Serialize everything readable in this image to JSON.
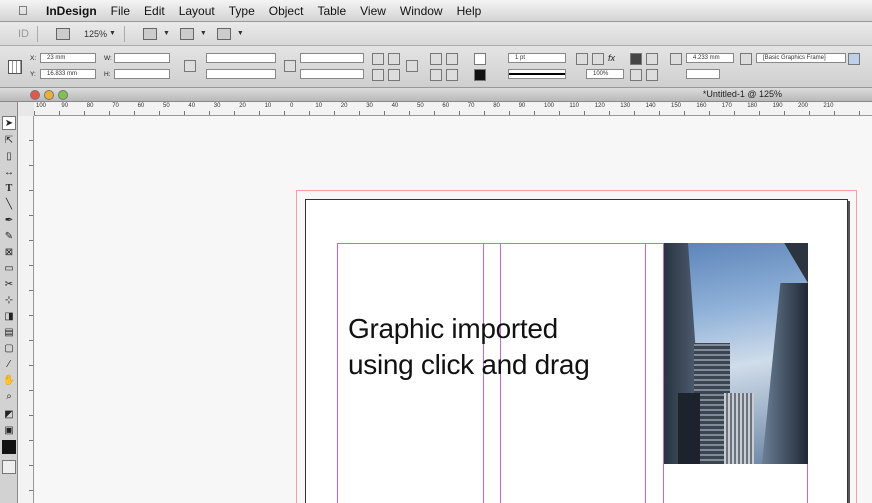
{
  "menubar": {
    "app_name": "InDesign",
    "items": [
      "File",
      "Edit",
      "Layout",
      "Type",
      "Object",
      "Table",
      "View",
      "Window",
      "Help"
    ]
  },
  "appbar": {
    "zoom": "125%"
  },
  "control": {
    "x_label": "X:",
    "x_value": "23 mm",
    "y_label": "Y:",
    "y_value": "16.833 mm",
    "w_label": "W:",
    "h_label": "H:",
    "stroke_weight": "1 pt",
    "opacity": "100%",
    "dimension": "4.233 mm",
    "object_style": "[Basic Graphics Frame]"
  },
  "document": {
    "title": "*Untitled-1 @ 125%"
  },
  "ruler": {
    "ticks": [
      "100",
      "90",
      "80",
      "70",
      "60",
      "50",
      "40",
      "30",
      "20",
      "10",
      "0",
      "10",
      "20",
      "30",
      "40",
      "50",
      "60",
      "70",
      "80",
      "90",
      "100",
      "110",
      "120",
      "130",
      "140",
      "150",
      "160",
      "170",
      "180",
      "190",
      "200",
      "210"
    ]
  },
  "canvas": {
    "line1": "Graphic imported",
    "line2": "using click and drag"
  },
  "colors": {
    "bleed": "#f4a0a0",
    "margin_guide": "#c36ad8"
  }
}
